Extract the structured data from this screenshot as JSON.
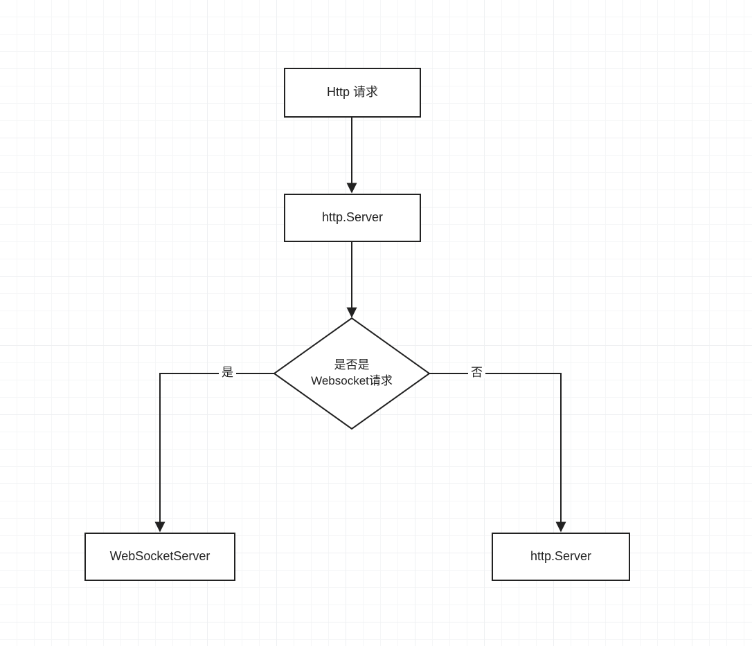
{
  "nodes": {
    "start": {
      "label": "Http 请求"
    },
    "server1": {
      "label": "http.Server"
    },
    "decision": {
      "line1": "是否是",
      "line2": "Websocket请求"
    },
    "wsServer": {
      "label": "WebSocketServer"
    },
    "server2": {
      "label": "http.Server"
    }
  },
  "edges": {
    "yes": "是",
    "no": "否"
  }
}
